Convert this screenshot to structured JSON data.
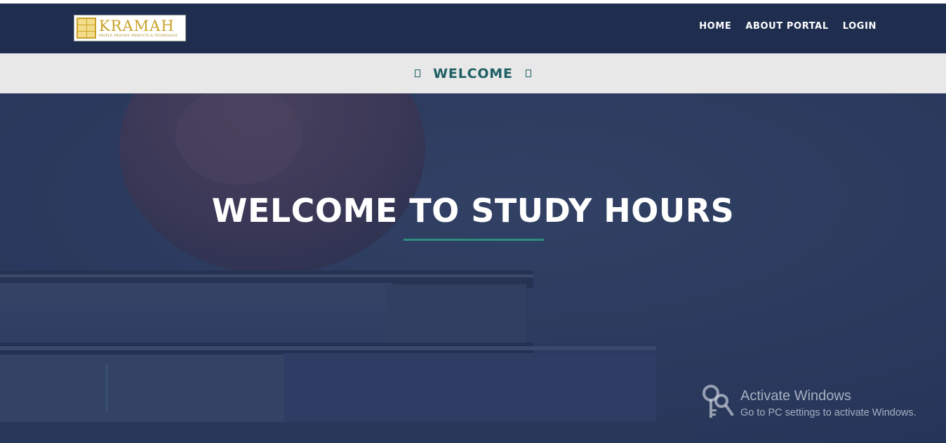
{
  "header": {
    "logo": {
      "word": "KRAMAH",
      "tagline": "PEOPLE, PROCESS, PRODUCTS & TECHNOLOGY",
      "brand_color": "#c9a227"
    },
    "nav": [
      {
        "label": "HOME"
      },
      {
        "label": "ABOUT PORTAL"
      },
      {
        "label": "LOGIN"
      }
    ],
    "background_color": "#1f2d4f"
  },
  "subbar": {
    "title": "WELCOME",
    "left_icon": "missing-glyph-icon",
    "right_icon": "missing-glyph-icon",
    "text_color": "#1e5f63"
  },
  "hero": {
    "title": "WELCOME TO STUDY HOURS",
    "accent_color": "#2b8f80",
    "background_image": "apple-on-books-photo"
  },
  "os_watermark": {
    "title": "Activate Windows",
    "subtitle": "Go to PC settings to activate Windows.",
    "icon": "keys-icon"
  }
}
